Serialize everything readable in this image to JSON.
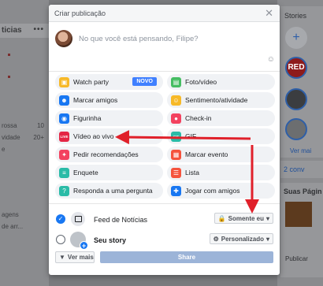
{
  "background": {
    "left": {
      "header": "ticias",
      "items": [
        "rossa",
        "vidade",
        "e",
        "agens",
        "de arr..."
      ],
      "counts": [
        "10",
        "20+"
      ]
    },
    "right": {
      "stories_label": "Stories",
      "ver_mais": "Ver mai",
      "conv_count": "2",
      "conv_label": "2 conv",
      "pages_label": "Suas Págin",
      "publicar_label": "Publicar",
      "red_story_text": "RED"
    }
  },
  "modal": {
    "title": "Criar publicação",
    "close_icon": "close-icon",
    "placeholder": "No que você está pensando, Filipe?",
    "options": [
      {
        "label": "Watch party",
        "icon": "tv-icon",
        "color": "#f7b928",
        "badge": "NOVO"
      },
      {
        "label": "Foto/vídeo",
        "icon": "photo-icon",
        "color": "#45bd62"
      },
      {
        "label": "Marcar amigos",
        "icon": "tag-friends-icon",
        "color": "#1877f2"
      },
      {
        "label": "Sentimento/atividade",
        "icon": "smile-icon",
        "color": "#f7b928"
      },
      {
        "label": "Figurinha",
        "icon": "sticker-icon",
        "color": "#1877f2"
      },
      {
        "label": "Check-in",
        "icon": "location-icon",
        "color": "#f3425f"
      },
      {
        "label": "Vídeo ao vivo",
        "icon": "live-video-icon",
        "color": "#e42645"
      },
      {
        "label": "GIF",
        "icon": "gif-icon",
        "color": "#2abba7"
      },
      {
        "label": "Pedir recomendações",
        "icon": "recommend-icon",
        "color": "#f3425f"
      },
      {
        "label": "Marcar evento",
        "icon": "calendar-icon",
        "color": "#f5533d"
      },
      {
        "label": "Enquete",
        "icon": "poll-icon",
        "color": "#2abba7"
      },
      {
        "label": "Lista",
        "icon": "list-icon",
        "color": "#f5533d"
      },
      {
        "label": "Responda a uma pergunta",
        "icon": "question-icon",
        "color": "#2abba7"
      },
      {
        "label": "Jogar com amigos",
        "icon": "game-icon",
        "color": "#1877f2"
      }
    ],
    "feed_label": "Feed de Notícias",
    "feed_privacy": "Somente eu",
    "story_label": "Seu story",
    "story_privacy": "Personalizado",
    "more_label": "Ver mais",
    "share_label": "Share"
  },
  "colors": {
    "accent": "#1877f2",
    "arrow": "#e0202a",
    "share_disabled": "#9cb4d8"
  }
}
